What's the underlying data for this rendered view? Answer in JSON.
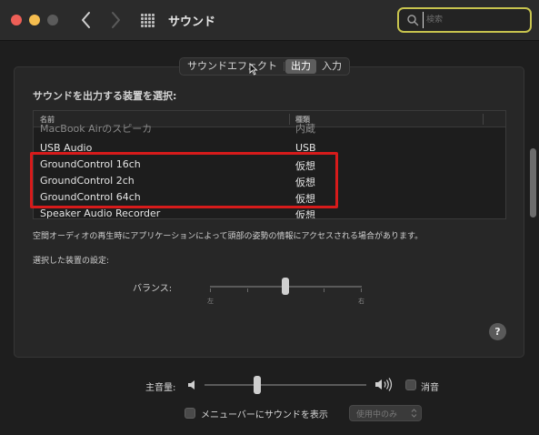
{
  "window": {
    "title": "サウンド"
  },
  "search": {
    "placeholder": "検索"
  },
  "tabs": [
    {
      "label": "サウンドエフェクト",
      "active": false
    },
    {
      "label": "出力",
      "active": true
    },
    {
      "label": "入力",
      "active": false
    }
  ],
  "output": {
    "select_device_label": "サウンドを出力する装置を選択:",
    "columns": {
      "name": "名前",
      "type": "種類"
    },
    "devices": [
      {
        "name": "MacBook Airのスピーカ",
        "type": "内蔵",
        "clipped": true
      },
      {
        "name": "USB Audio",
        "type": "USB"
      },
      {
        "name": "GroundControl 16ch",
        "type": "仮想",
        "highlighted": true
      },
      {
        "name": "GroundControl 2ch",
        "type": "仮想",
        "highlighted": true
      },
      {
        "name": "GroundControl 64ch",
        "type": "仮想",
        "highlighted": true
      },
      {
        "name": "Speaker Audio Recorder",
        "type": "仮想"
      }
    ],
    "spatial_audio_note": "空間オーディオの再生時にアプリケーションによって頭部の姿勢の情報にアクセスされる場合があります。",
    "selected_device_settings_label": "選択した装置の設定:",
    "balance": {
      "label": "バランス:",
      "left_label": "左",
      "right_label": "右",
      "value": 0.5
    },
    "help_label": "?"
  },
  "volume": {
    "label": "主音量:",
    "value": 0.32,
    "mute_label": "消音",
    "mute_checked": false
  },
  "menubar": {
    "label": "メニューバーにサウンドを表示",
    "checked": false,
    "select_value": "使用中のみ"
  },
  "colors": {
    "highlight_box": "#d71b1b",
    "search_border": "#c8c44e",
    "close": "#ee5f57",
    "minimize": "#f5bd4f"
  },
  "icons": [
    "back-chevron-icon",
    "forward-chevron-icon",
    "grid-icon",
    "search-icon",
    "question-icon",
    "speaker-low-icon",
    "speaker-high-icon",
    "select-chevron-icon"
  ]
}
